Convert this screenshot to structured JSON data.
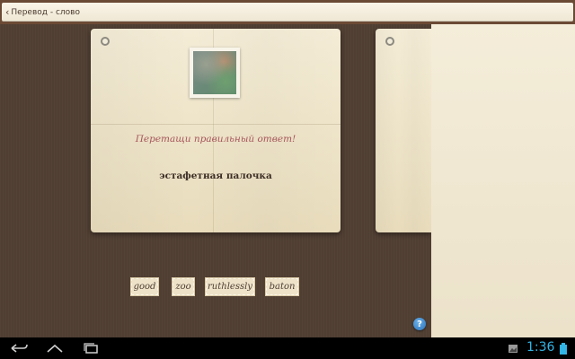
{
  "header": {
    "back_label": "Перевод - слово"
  },
  "card": {
    "prompt": "Перетащи правильный ответ!",
    "word": "эстафетная палочка"
  },
  "options": [
    "good",
    "zoo",
    "ruthlessly",
    "baton"
  ],
  "help_label": "?",
  "status_bar": {
    "time": "1:36"
  },
  "colors": {
    "accent_clock": "#33b5e5",
    "prompt": "#a5555a",
    "background": "#513f33"
  }
}
